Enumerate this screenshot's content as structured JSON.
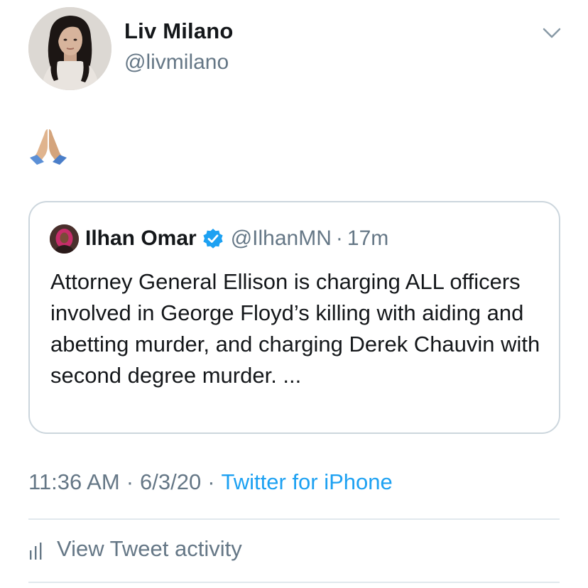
{
  "author": {
    "name": "Liv Milano",
    "handle": "@livmilano",
    "avatar_icon": "profile-photo"
  },
  "tweet": {
    "emoji": "🙏",
    "emoji_icon": "folded-hands-icon"
  },
  "quoted_tweet": {
    "name": "Ilhan Omar",
    "handle": "@IlhanMN",
    "separator": "·",
    "time": "17m",
    "verified_icon": "verified-badge-icon",
    "text": "Attorney General Ellison is charging ALL officers involved in George Floyd’s killing with aiding and abetting murder, and charging Derek Chauvin with second degree murder. ..."
  },
  "meta": {
    "time": "11:36 AM",
    "separator": "·",
    "date": "6/3/20",
    "source": "Twitter for iPhone"
  },
  "activity": {
    "label": "View Tweet activity",
    "icon": "bar-chart-icon"
  },
  "colors": {
    "link": "#1da1f2",
    "secondary_text": "#657786",
    "border": "#ccd6dd",
    "divider": "#e1e8ed"
  }
}
